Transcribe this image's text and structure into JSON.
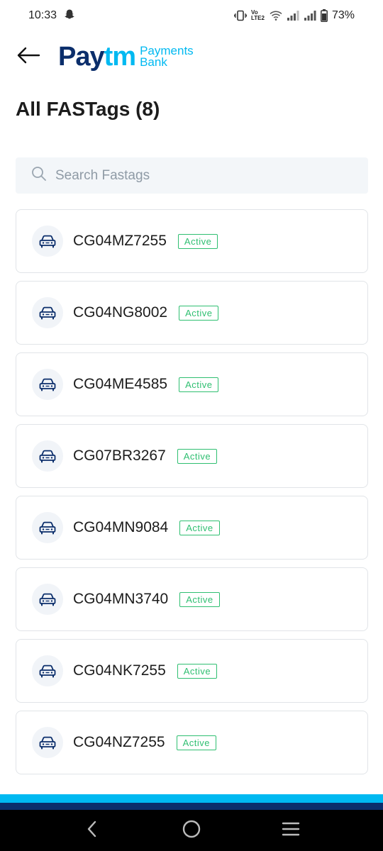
{
  "status_bar": {
    "time": "10:33",
    "notification_icon": "snapchat-ghost-icon",
    "network_label": "Vo LTE2",
    "battery_percent": "73%"
  },
  "header": {
    "back_icon": "arrow-left-icon",
    "logo_pay": "Pay",
    "logo_tm": "tm",
    "logo_payments": "Payments",
    "logo_bank": "Bank"
  },
  "page": {
    "title": "All FASTags (8)"
  },
  "search": {
    "placeholder": "Search Fastags",
    "value": "",
    "icon": "search-icon"
  },
  "fastags": [
    {
      "number": "CG04MZ7255",
      "status": "Active"
    },
    {
      "number": "CG04NG8002",
      "status": "Active"
    },
    {
      "number": "CG04ME4585",
      "status": "Active"
    },
    {
      "number": "CG07BR3267",
      "status": "Active"
    },
    {
      "number": "CG04MN9084",
      "status": "Active"
    },
    {
      "number": "CG04MN3740",
      "status": "Active"
    },
    {
      "number": "CG04NK7255",
      "status": "Active"
    },
    {
      "number": "CG04NZ7255",
      "status": "Active"
    }
  ],
  "colors": {
    "brand_dark": "#0b2e6b",
    "brand_light": "#00b9f1",
    "active_green": "#2fbf71"
  },
  "nav_bar": {
    "icons": [
      "back-icon",
      "home-icon",
      "recents-menu-icon"
    ]
  }
}
